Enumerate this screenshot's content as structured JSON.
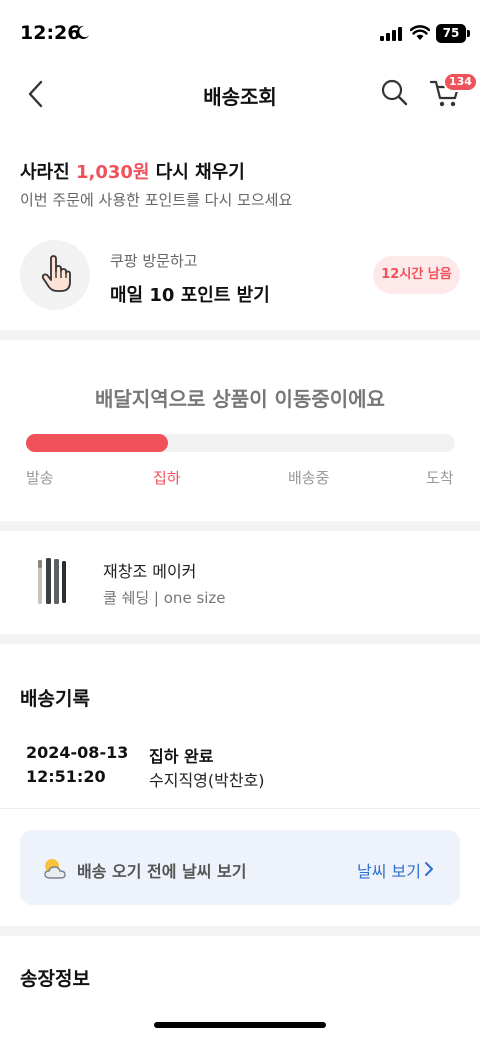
{
  "status_bar": {
    "time": "12:26",
    "battery": "75"
  },
  "header": {
    "title": "배송조회",
    "cart_count": "134"
  },
  "points_promo": {
    "title_prefix": "사라진 ",
    "amount": "1,030원",
    "title_suffix": " 다시 채우기",
    "subtitle": "이번 주문에 사용한 포인트를 다시 모으세요",
    "visit_line1": "쿠팡 방문하고",
    "visit_line2": "매일 10 포인트 받기",
    "time_left": "12시간 남음"
  },
  "tracking": {
    "headline": "배달지역으로 상품이 이동중이에요",
    "progress": 0.33,
    "steps": [
      "발송",
      "집하",
      "배송중",
      "도착"
    ],
    "active_step": 1
  },
  "product": {
    "name": "재창조 메이커",
    "option": "쿨 쉐딩 | one size"
  },
  "delivery_log": {
    "title": "배송기록",
    "entries": [
      {
        "date": "2024-08-13",
        "time": "12:51:20",
        "status": "집하 완료",
        "location": "수지직영(박찬호)"
      }
    ]
  },
  "weather": {
    "text": "배송 오기 전에 날씨 보기",
    "link": "날씨 보기"
  },
  "invoice": {
    "title": "송장정보"
  },
  "colors": {
    "accent": "#f0525c",
    "link": "#2f6fcf",
    "card_bg": "#eef3fb"
  },
  "icons": [
    "moon-icon",
    "signal-icon",
    "wifi-icon",
    "back-icon",
    "search-icon",
    "cart-icon",
    "hand-tap-icon",
    "weather-icon",
    "chevron-right-icon"
  ]
}
